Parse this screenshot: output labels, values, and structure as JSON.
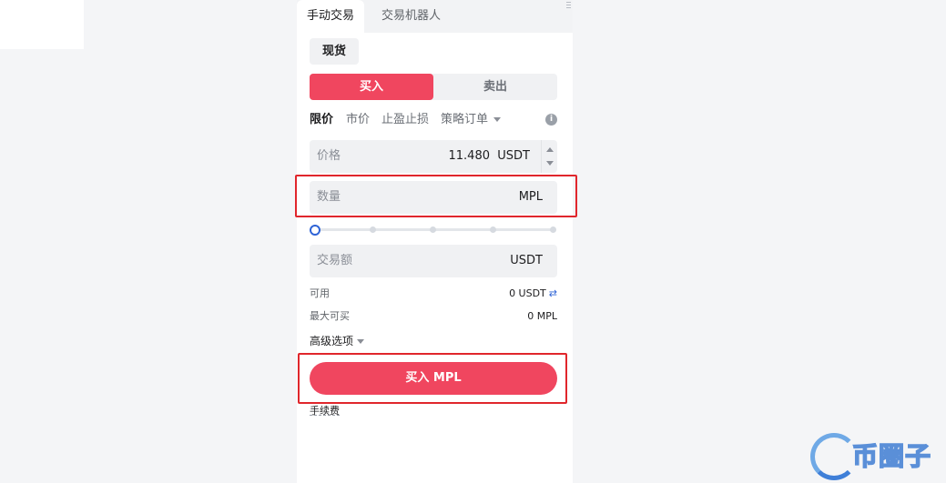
{
  "tabs": {
    "manual": "手动交易",
    "bot": "交易机器人"
  },
  "market": {
    "spot_label": "现货"
  },
  "side": {
    "buy": "买入",
    "sell": "卖出"
  },
  "order_types": {
    "limit": "限价",
    "market": "市价",
    "tp_sl": "止盈止损",
    "strategy": "策略订单"
  },
  "price_field": {
    "label": "价格",
    "value": "11.480",
    "unit": "USDT"
  },
  "quantity_field": {
    "label": "数量",
    "unit": "MPL"
  },
  "slider": {
    "percent": 0
  },
  "amount_field": {
    "label": "交易额",
    "unit": "USDT"
  },
  "available": {
    "label": "可用",
    "value": "0 USDT"
  },
  "max_buy": {
    "label": "最大可买",
    "value": "0 MPL"
  },
  "advanced": {
    "label": "高级选项"
  },
  "submit": {
    "label": "买入 MPL"
  },
  "fee": {
    "label": "手续费"
  },
  "watermark": {
    "text": "币圈子"
  },
  "colors": {
    "buy": "#f0465f",
    "highlight": "#e0262c",
    "accent": "#2e63d6"
  }
}
